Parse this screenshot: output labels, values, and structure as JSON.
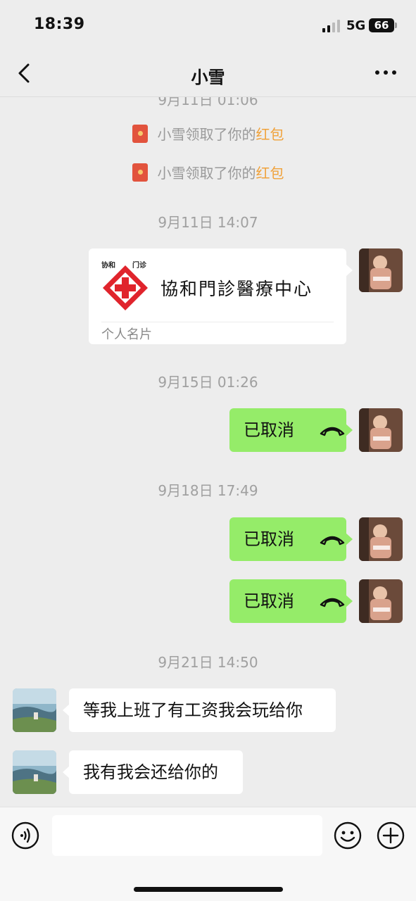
{
  "status_bar": {
    "time": "18:39",
    "network": "5G",
    "battery": "66"
  },
  "header": {
    "title": "小雪",
    "back_icon": "chevron-left-icon",
    "more_icon": "ellipsis-icon"
  },
  "messages": {
    "partial_timestamp": "9月11日 01:06",
    "sys1": {
      "prefix": "小雪领取了你的",
      "highlight": "红包"
    },
    "sys2": {
      "prefix": "小雪领取了你的",
      "highlight": "红包"
    },
    "ts1": "9月11日 14:07",
    "card": {
      "logo_top_left": "协和",
      "logo_top_right": "门诊",
      "name": "協和門診醫療中心",
      "type": "个人名片"
    },
    "ts2": "9月15日 01:26",
    "call1": "已取消",
    "ts3": "9月18日 17:49",
    "call2": "已取消",
    "call3": "已取消",
    "ts4": "9月21日 14:50",
    "text1": "等我上班了有工资我会玩给你",
    "text2": "我有我会还给你的"
  },
  "colors": {
    "my_bubble": "#95ec69",
    "their_bubble": "#ffffff",
    "background": "#ededed",
    "red_packet_highlight": "#f0a23b"
  },
  "input_bar": {
    "voice_icon": "voice-icon",
    "emoji_icon": "emoji-icon",
    "plus_icon": "plus-icon",
    "text": ""
  }
}
